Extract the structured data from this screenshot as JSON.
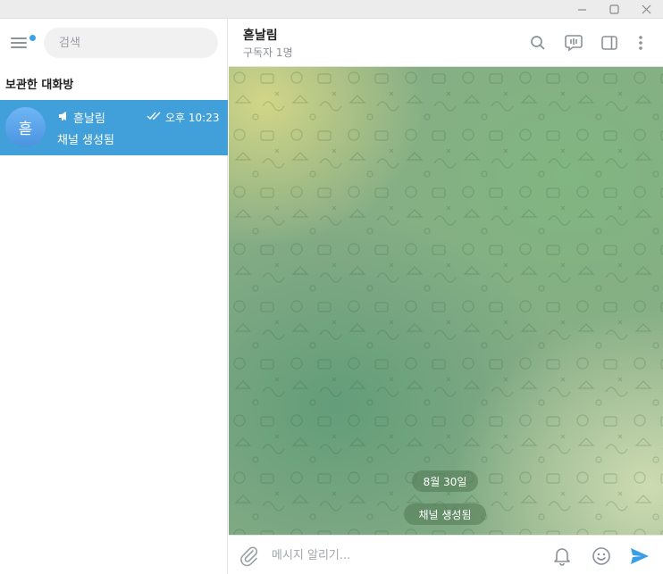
{
  "window": {
    "minimize_icon": "minimize-icon",
    "maximize_icon": "maximize-icon",
    "close_icon": "close-icon"
  },
  "sidebar": {
    "menu_icon": "hamburger-menu-icon",
    "search": {
      "placeholder": "검색",
      "value": ""
    },
    "section_title": "보관한 대화방",
    "chats": [
      {
        "avatar_letter": "흗",
        "name": "흗날림",
        "time": "오후 10:23",
        "preview": "채널 생성됨",
        "selected": true,
        "is_channel": true,
        "read": true
      }
    ]
  },
  "chat": {
    "title": "흗날림",
    "subtitle": "구독자 1명",
    "header_icons": [
      "search-icon",
      "live-chat-icon",
      "sidebar-toggle-icon",
      "more-vertical-icon"
    ],
    "messages": [
      {
        "type": "date",
        "text": "8월 30일"
      },
      {
        "type": "service",
        "text": "채널 생성됨"
      }
    ],
    "composer": {
      "placeholder": "메시지 알리기...",
      "value": ""
    }
  },
  "colors": {
    "accent": "#419fd9",
    "send": "#3a9ee6",
    "unread_dot": "#3ba3e5"
  }
}
